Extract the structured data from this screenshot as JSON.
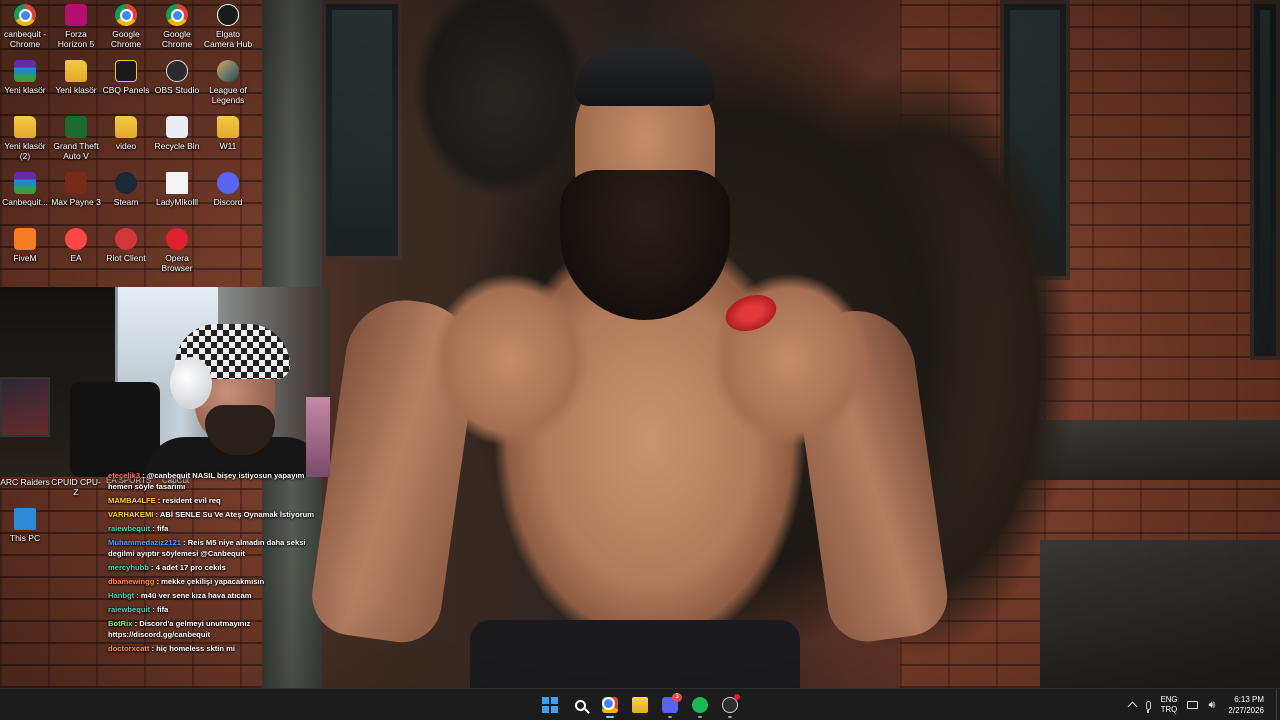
{
  "desktop": {
    "icons": [
      {
        "label": "canbequit - Chrome",
        "icon": "chrome-icon"
      },
      {
        "label": "Forza Horizon 5",
        "icon": "forza-icon"
      },
      {
        "label": "Google Chrome",
        "icon": "chrome-icon"
      },
      {
        "label": "Google Chrome",
        "icon": "chrome-icon"
      },
      {
        "label": "Elgato Camera Hub",
        "icon": "elgato-icon"
      },
      {
        "label": "Yeni klasör",
        "icon": "winrar-icon"
      },
      {
        "label": "Yeni klasör",
        "icon": "folder-icon"
      },
      {
        "label": "CBQ Panels",
        "icon": "cbq-icon"
      },
      {
        "label": "OBS Studio",
        "icon": "obs-icon"
      },
      {
        "label": "League of Legends",
        "icon": "league-icon"
      },
      {
        "label": "Yeni klasör (2)",
        "icon": "folder-icon"
      },
      {
        "label": "Grand Theft Auto V",
        "icon": "gta-icon"
      },
      {
        "label": "video",
        "icon": "folder-icon"
      },
      {
        "label": "Recycle Bin",
        "icon": "recycle-bin-icon"
      },
      {
        "label": "W11",
        "icon": "folder-icon"
      },
      {
        "label": "Canbequit...",
        "icon": "winrar-icon"
      },
      {
        "label": "Max Payne 3",
        "icon": "max-payne-icon"
      },
      {
        "label": "Steam",
        "icon": "steam-icon"
      },
      {
        "label": "LadyMikolll",
        "icon": "document-icon"
      },
      {
        "label": "Discord",
        "icon": "discord-icon"
      },
      {
        "label": "FiveM",
        "icon": "fivem-icon"
      },
      {
        "label": "EA",
        "icon": "ea-icon"
      },
      {
        "label": "Riot Client",
        "icon": "riot-icon"
      },
      {
        "label": "Opera Browser",
        "icon": "opera-icon"
      },
      {
        "label": "ARC Raiders",
        "icon": "arc-raiders-icon"
      },
      {
        "label": "CPUID CPU-Z",
        "icon": "cpuz-icon"
      },
      {
        "label": "This PC",
        "icon": "this-pc-icon"
      }
    ],
    "partial_labels": [
      "EA SPORTS",
      "CapCut"
    ]
  },
  "chat": {
    "messages": [
      {
        "user": "eteçelik3",
        "color": "#ff6a6a",
        "text": "@canbequit NASIL bişey istiyosun yapayım hemen söyle tasarımı"
      },
      {
        "user": "MAMBA4LFE",
        "color": "#ffd23a",
        "text": "resident evil req"
      },
      {
        "user": "VARHAKEMI",
        "color": "#ffd23a",
        "text": "ABİ SENLE Su Ve Ateş Oynamak İstiyorum"
      },
      {
        "user": "raiewbequit",
        "color": "#48d1b4",
        "text": "fifa"
      },
      {
        "user": "Muhammedaziz2121",
        "color": "#4a9bff",
        "text": "Reis M5 niye almadın daha seksi degilmi ayıptır söylemesi @Canbequit"
      },
      {
        "user": "mercyhubb",
        "color": "#48d1b4",
        "text": "4 adet 17 pro cekıls"
      },
      {
        "user": "dbamewingg",
        "color": "#ff8c3a",
        "text": "mekke çekilişi yapacakmısın"
      },
      {
        "user": "Hanbgt",
        "color": "#48d1b4",
        "text": "m4ü ver sene kıza hava atıcam"
      },
      {
        "user": "raiewbequit",
        "color": "#48d1b4",
        "text": "fifa"
      },
      {
        "user": "BotRix",
        "color": "#7cf06a",
        "text": "Discord'a gelmeyi unutmayınız https://discord.gg/canbequit"
      },
      {
        "user": "doctorxcatt",
        "color": "#ff8c3a",
        "text": "hiç homeless sktin mi"
      }
    ],
    "separator": " : "
  },
  "taskbar": {
    "apps": [
      {
        "name": "start",
        "icon": "windows-start-icon"
      },
      {
        "name": "search",
        "icon": "search-icon"
      },
      {
        "name": "chrome",
        "icon": "chrome-icon"
      },
      {
        "name": "file-explorer",
        "icon": "folder-icon"
      },
      {
        "name": "discord",
        "icon": "discord-icon",
        "badge": "3"
      },
      {
        "name": "spotify",
        "icon": "spotify-icon"
      },
      {
        "name": "obs",
        "icon": "obs-icon"
      }
    ],
    "tray": {
      "lang_top": "ENG",
      "lang_bottom": "TRQ",
      "time": "6:13 PM",
      "date": "2/27/2026"
    }
  }
}
